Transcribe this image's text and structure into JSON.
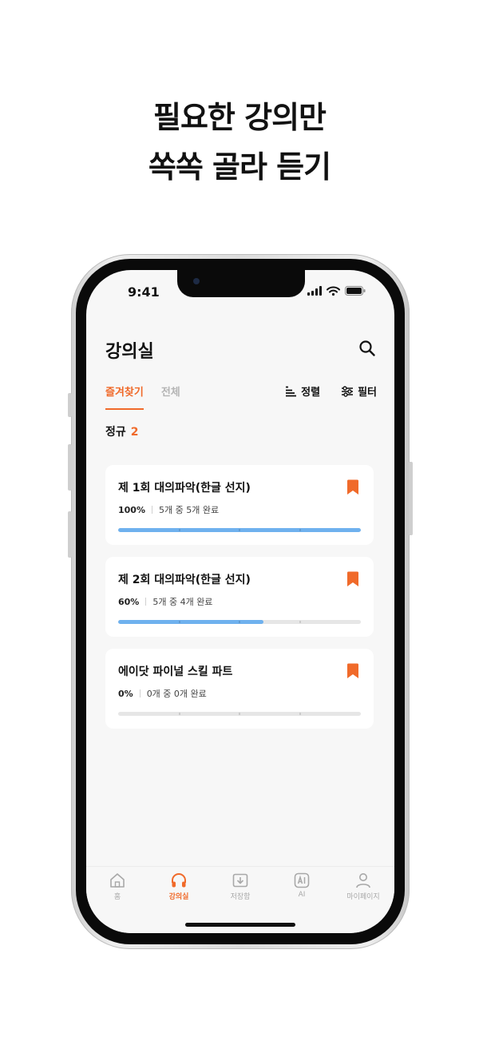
{
  "headline": {
    "line1": "필요한 강의만",
    "line2": "쏙쏙 골라 듣기"
  },
  "status_bar": {
    "time": "9:41"
  },
  "header": {
    "title": "강의실"
  },
  "tabs": [
    {
      "label": "즐겨찾기",
      "active": true
    },
    {
      "label": "전체",
      "active": false
    }
  ],
  "tools": {
    "sort_label": "정렬",
    "filter_label": "필터"
  },
  "section": {
    "label": "정규",
    "count": "2"
  },
  "courses": [
    {
      "title": "제 1회 대의파악(한글 선지)",
      "percent": "100%",
      "summary": "5개 중 5개 완료",
      "progress": 1.0
    },
    {
      "title": "제 2회 대의파악(한글 선지)",
      "percent": "60%",
      "summary": "5개 중 4개 완료",
      "progress": 0.6
    },
    {
      "title": "에이닷 파이널 스킬 파트",
      "percent": "0%",
      "summary": "0개 중 0개 완료",
      "progress": 0.0
    }
  ],
  "bottom_nav": [
    {
      "label": "홈",
      "icon": "home-icon",
      "active": false
    },
    {
      "label": "강의실",
      "icon": "headphones-icon",
      "active": true
    },
    {
      "label": "저장함",
      "icon": "download-folder-icon",
      "active": false
    },
    {
      "label": "AI",
      "icon": "ai-icon",
      "active": false
    },
    {
      "label": "마이페이지",
      "icon": "person-icon",
      "active": false
    }
  ],
  "colors": {
    "accent": "#f06a2a",
    "progress": "#6fb1ee",
    "track": "#e6e6e6",
    "screen_bg": "#f7f7f7"
  }
}
